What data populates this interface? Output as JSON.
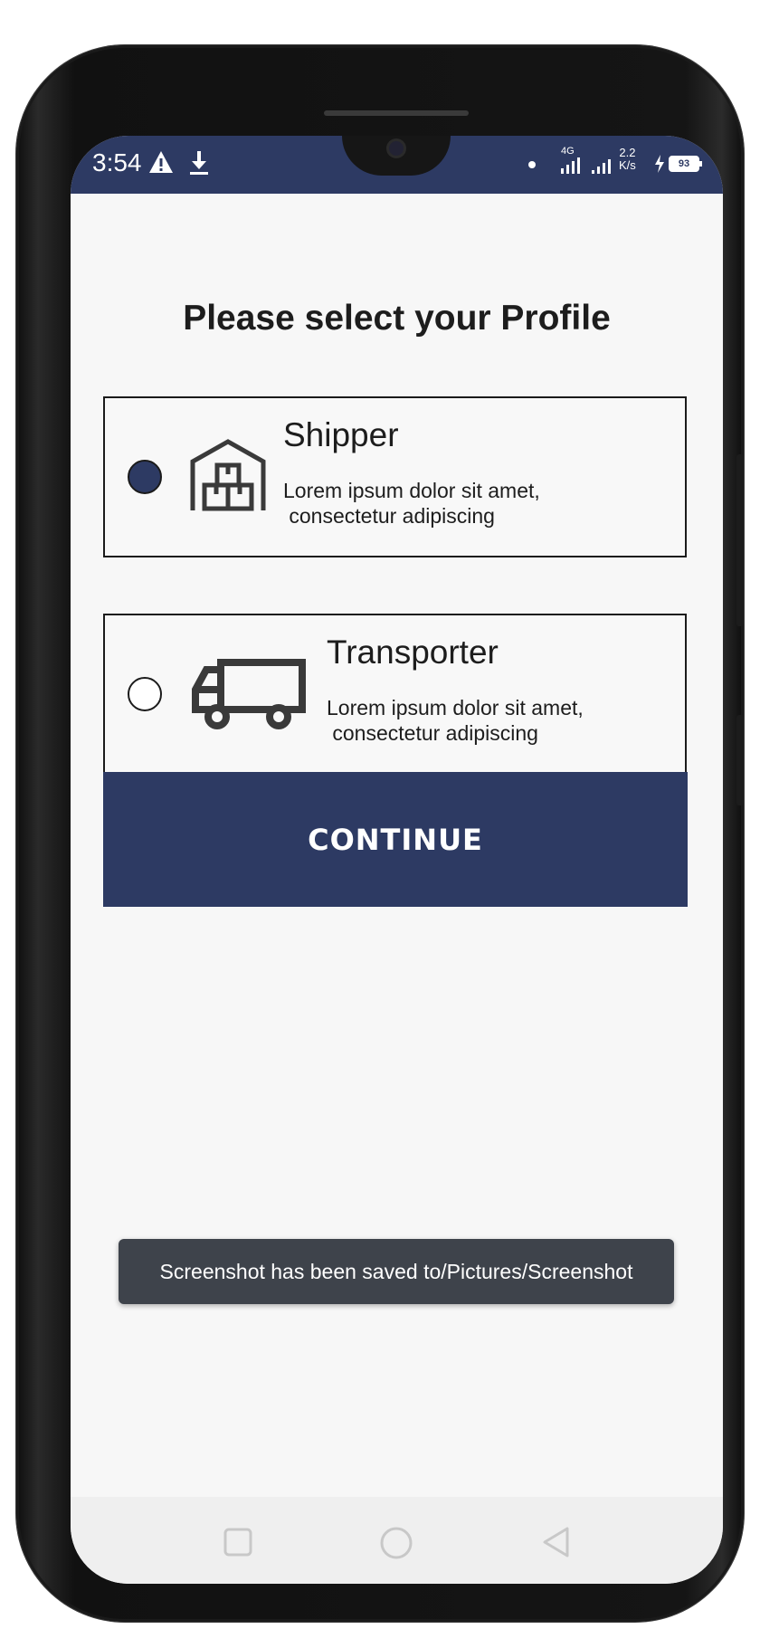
{
  "status_bar": {
    "time": "3:54",
    "warning_icon": "warning-icon",
    "download_icon": "download-icon",
    "network_type": "4G",
    "net_speed_value": "2.2",
    "net_speed_unit": "K/s",
    "battery_level": "93",
    "background_color": "#2d3a63"
  },
  "main": {
    "title": "Please select your Profile",
    "profiles": [
      {
        "name": "Shipper",
        "description": "Lorem ipsum dolor sit amet,\n consectetur adipiscing",
        "icon": "warehouse-icon",
        "selected": true
      },
      {
        "name": "Transporter",
        "description": "Lorem ipsum dolor sit amet,\n consectetur adipiscing",
        "icon": "truck-icon",
        "selected": false
      }
    ],
    "continue_label": "CONTINUE",
    "accent_color": "#2d3a63"
  },
  "toast": {
    "message": "Screenshot has been saved to/Pictures/Screenshot"
  },
  "nav_bar": {
    "buttons": [
      "recents-icon",
      "home-icon",
      "back-icon"
    ]
  }
}
